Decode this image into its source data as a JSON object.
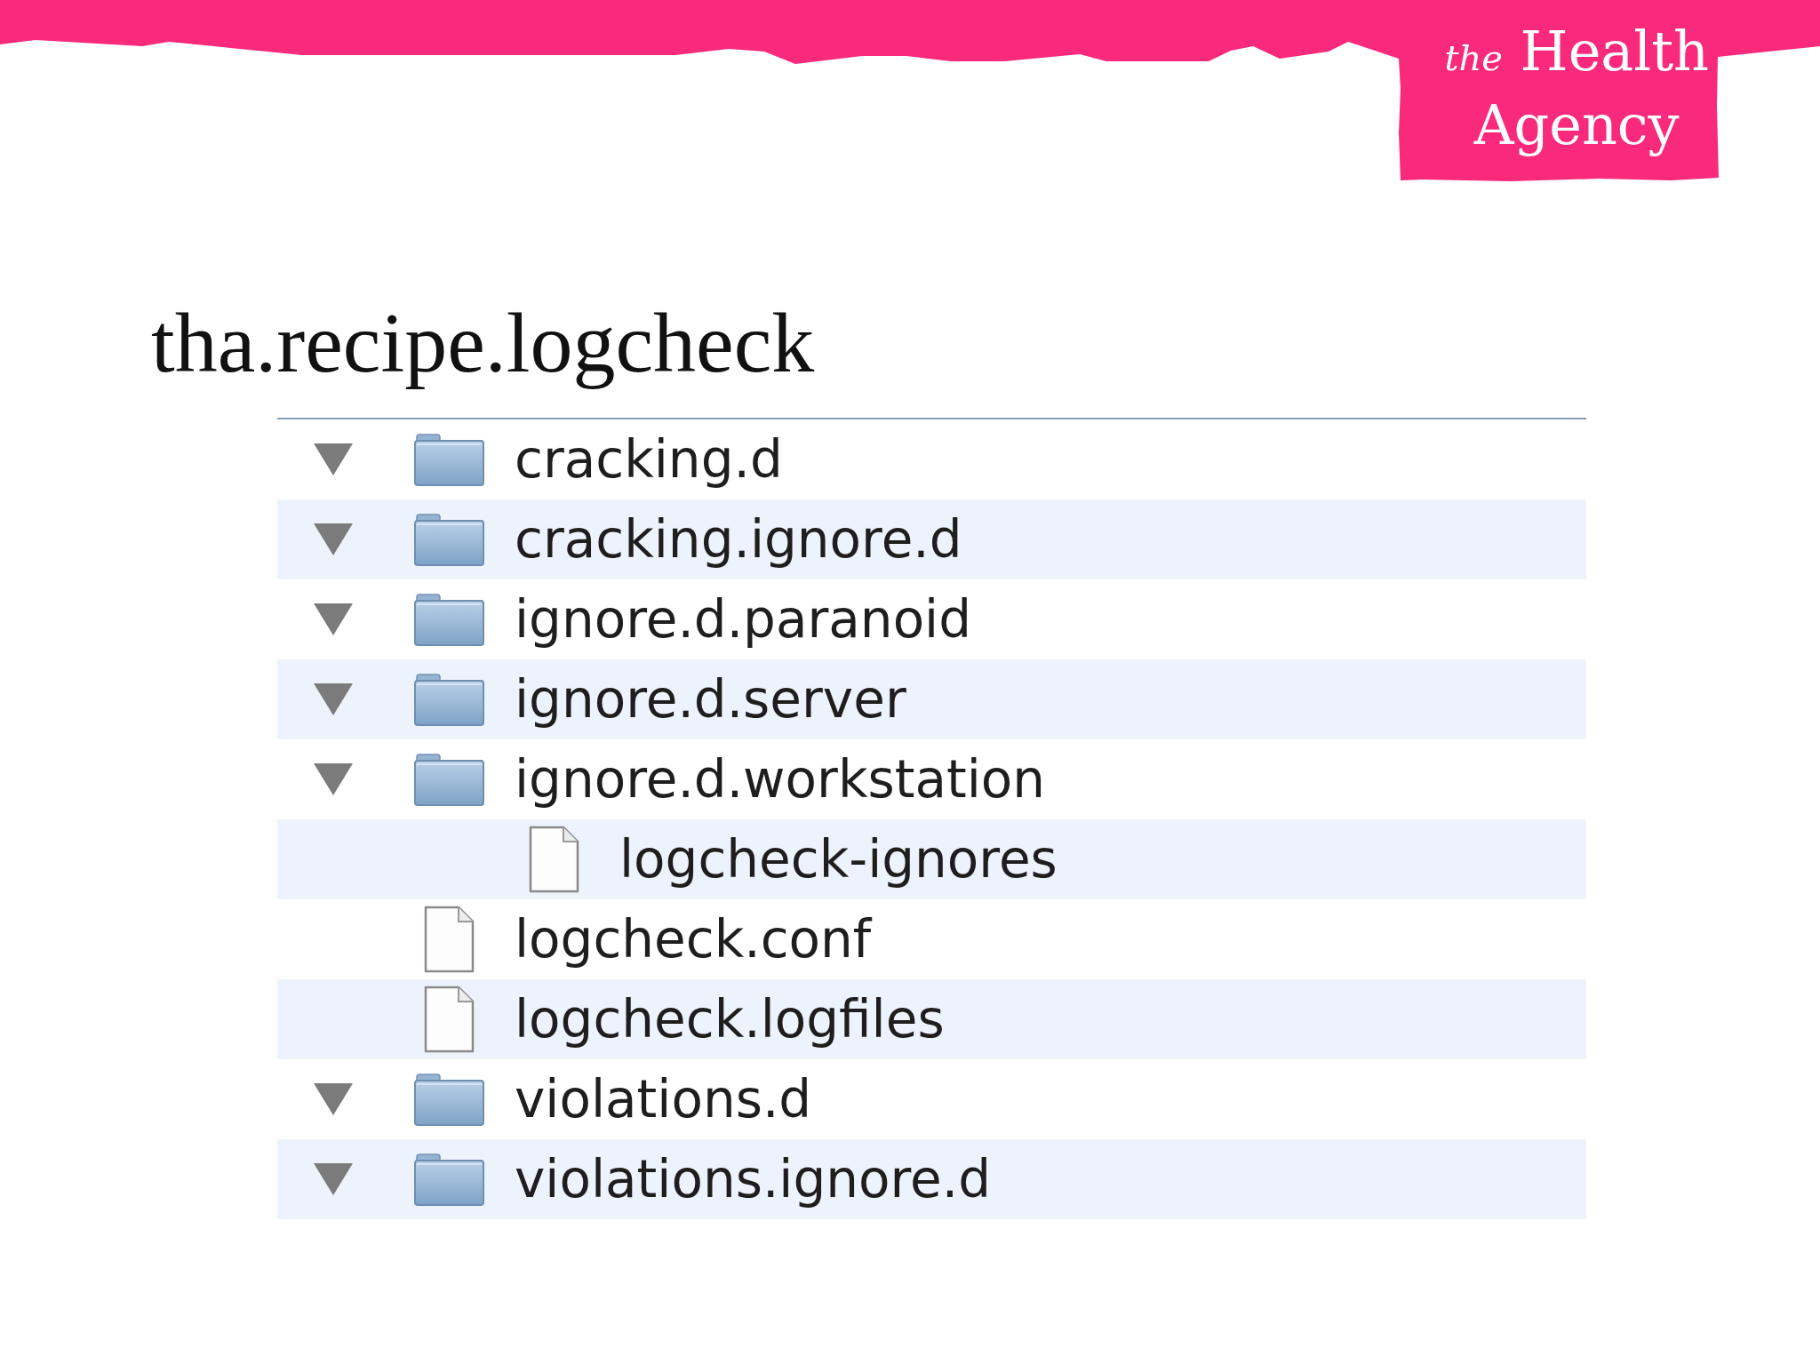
{
  "banner": {
    "logo": {
      "article": "the",
      "lines": [
        "Health",
        "Agency"
      ]
    }
  },
  "title": "tha.recipe.logcheck",
  "file_list": {
    "items": [
      {
        "name": "cracking.d",
        "kind": "folder",
        "expanded": true
      },
      {
        "name": "cracking.ignore.d",
        "kind": "folder",
        "expanded": true
      },
      {
        "name": "ignore.d.paranoid",
        "kind": "folder",
        "expanded": true
      },
      {
        "name": "ignore.d.server",
        "kind": "folder",
        "expanded": true
      },
      {
        "name": "ignore.d.workstation",
        "kind": "folder",
        "expanded": true,
        "children": [
          {
            "name": "logcheck-ignores",
            "kind": "file"
          }
        ]
      },
      {
        "name": "logcheck.conf",
        "kind": "file"
      },
      {
        "name": "logcheck.logfiles",
        "kind": "file"
      },
      {
        "name": "violations.d",
        "kind": "folder",
        "expanded": true
      },
      {
        "name": "violations.ignore.d",
        "kind": "folder",
        "expanded": true
      }
    ]
  }
}
